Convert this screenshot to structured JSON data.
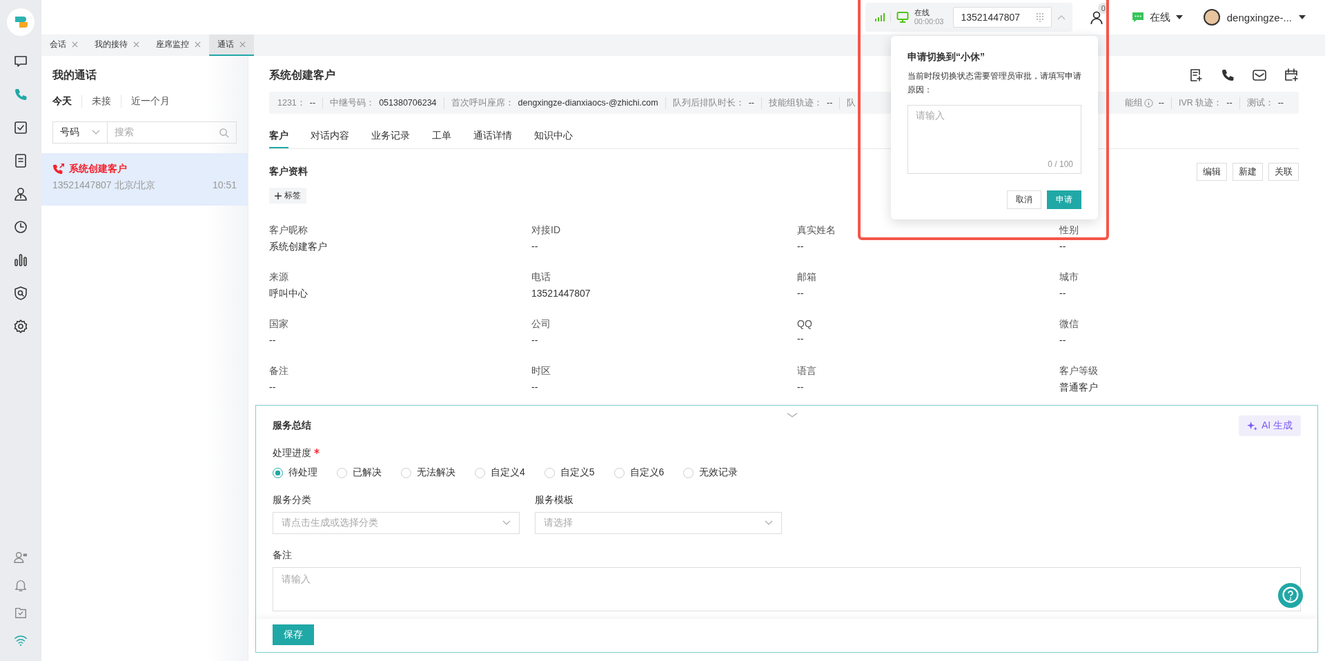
{
  "rail": {
    "nav": [
      {
        "kind": "chat",
        "selected": false
      },
      {
        "kind": "phone",
        "selected": true
      },
      {
        "kind": "task",
        "selected": false
      },
      {
        "kind": "doc",
        "selected": false
      },
      {
        "kind": "contact",
        "selected": false
      },
      {
        "kind": "clock",
        "selected": false
      },
      {
        "kind": "chart",
        "selected": false
      },
      {
        "kind": "shield",
        "selected": false
      },
      {
        "kind": "gear",
        "selected": false
      }
    ],
    "bottom": [
      {
        "kind": "agent"
      },
      {
        "kind": "bell"
      },
      {
        "kind": "folder"
      },
      {
        "kind": "wifi"
      }
    ]
  },
  "topbar": {
    "call_widget": {
      "status": "在线",
      "timer": "00:00:03",
      "number": "13521447807"
    },
    "badge": "0",
    "status": "在线",
    "user": "dengxingze-..."
  },
  "tabs": [
    {
      "label": "会话",
      "selected": false
    },
    {
      "label": "我的接待",
      "selected": false
    },
    {
      "label": "座席监控",
      "selected": false
    },
    {
      "label": "通话",
      "selected": true
    }
  ],
  "call_list": {
    "title": "我的通话",
    "filters": [
      {
        "label": "今天",
        "selected": true
      },
      {
        "label": "未接",
        "selected": false
      },
      {
        "label": "近一个月",
        "selected": false
      }
    ],
    "search": {
      "type": "号码",
      "placeholder": "搜索"
    },
    "calls": [
      {
        "name": "系统创建客户",
        "detail": "13521447807 北京/北京",
        "time": "10:51",
        "selected": true,
        "missed": true
      }
    ]
  },
  "main": {
    "title": "系统创建客户",
    "info_left": [
      {
        "label": "1231：",
        "value": "--"
      },
      {
        "label": "中继号码：",
        "value": "051380706234"
      },
      {
        "label": "首次呼叫座席：",
        "value": "dengxingze-dianxiaocs-@zhichi.com"
      },
      {
        "label": "队列后排队时长：",
        "value": "--"
      },
      {
        "label": "技能组轨迹：",
        "value": "--"
      },
      {
        "label": "队"
      }
    ],
    "info_right": [
      {
        "label": "能组",
        "hint": true,
        "value": "--"
      },
      {
        "label": "IVR 轨迹：",
        "hint": false,
        "value": "--"
      },
      {
        "label": "测试：",
        "hint": false,
        "value": "--"
      }
    ],
    "tabs": [
      {
        "label": "客户",
        "selected": true
      },
      {
        "label": "对话内容",
        "selected": false
      },
      {
        "label": "业务记录",
        "selected": false
      },
      {
        "label": "工单",
        "selected": false
      },
      {
        "label": "通话详情",
        "selected": false
      },
      {
        "label": "知识中心",
        "selected": false
      }
    ],
    "section_title": "客户资料",
    "section_buttons": [
      "编辑",
      "新建",
      "关联"
    ],
    "tag_button": "标签",
    "fields": [
      {
        "label": "客户昵称",
        "value": "系统创建客户"
      },
      {
        "label": "对接ID",
        "value": "--"
      },
      {
        "label": "真实姓名",
        "value": "--"
      },
      {
        "label": "性别",
        "value": "--"
      },
      {
        "label": "来源",
        "value": "呼叫中心"
      },
      {
        "label": "电话",
        "value": "13521447807"
      },
      {
        "label": "邮箱",
        "value": "--"
      },
      {
        "label": "城市",
        "value": "--"
      },
      {
        "label": "国家",
        "value": "--"
      },
      {
        "label": "公司",
        "value": "--"
      },
      {
        "label": "QQ",
        "value": "--"
      },
      {
        "label": "微信",
        "value": "--"
      },
      {
        "label": "备注",
        "value": "--"
      },
      {
        "label": "时区",
        "value": "--"
      },
      {
        "label": "语言",
        "value": "--"
      },
      {
        "label": "客户等级",
        "value": "普通客户"
      }
    ]
  },
  "summary": {
    "title": "服务总结",
    "ai_button": "AI 生成",
    "progress": {
      "label": "处理进度",
      "required": true,
      "options": [
        {
          "label": "待处理",
          "selected": true
        },
        {
          "label": "已解决",
          "selected": false
        },
        {
          "label": "无法解决",
          "selected": false
        },
        {
          "label": "自定义4",
          "selected": false
        },
        {
          "label": "自定义5",
          "selected": false
        },
        {
          "label": "自定义6",
          "selected": false
        },
        {
          "label": "无效记录",
          "selected": false
        }
      ]
    },
    "category": {
      "label": "服务分类",
      "placeholder": "请点击生成或选择分类"
    },
    "template": {
      "label": "服务模板",
      "placeholder": "请选择"
    },
    "remark": {
      "label": "备注",
      "placeholder": "请输入"
    },
    "save": "保存"
  },
  "popup": {
    "title": "申请切换到“小休”",
    "message": "当前时段切换状态需要管理员审批，请填写申请原因：",
    "placeholder": "请输入",
    "counter": "0 / 100",
    "buttons": [
      {
        "label": "取消",
        "kind": "default"
      },
      {
        "label": "申请",
        "kind": "primary"
      }
    ]
  },
  "highlight_frame": true
}
